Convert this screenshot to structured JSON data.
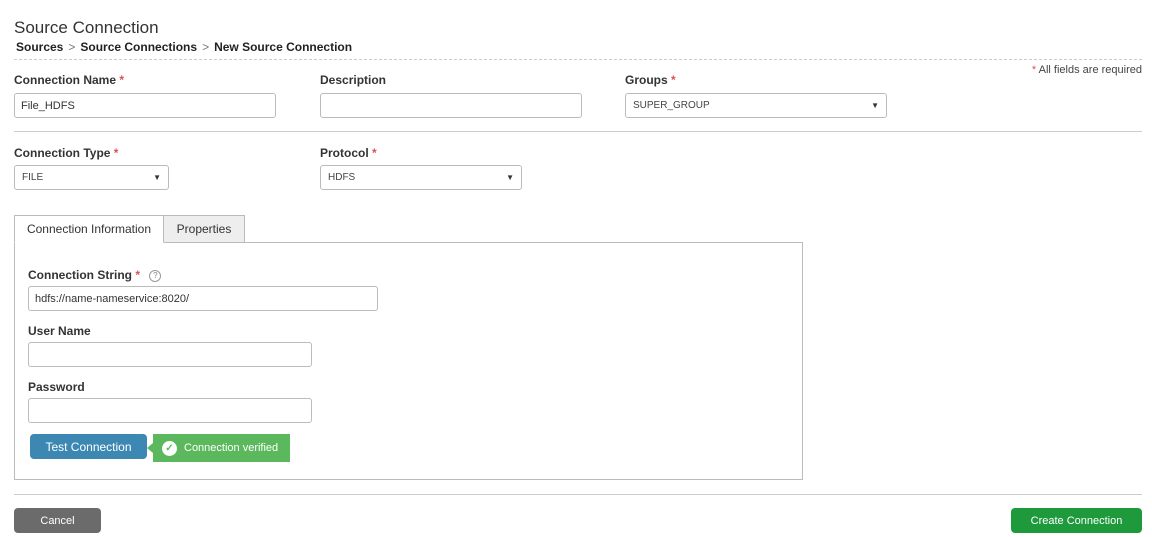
{
  "header": {
    "title": "Source Connection",
    "breadcrumb": [
      "Sources",
      "Source Connections",
      "New Source Connection"
    ],
    "required_note": "All fields are required",
    "required_marker": "*"
  },
  "form": {
    "connection_name": {
      "label": "Connection Name",
      "value": "File_HDFS"
    },
    "description": {
      "label": "Description",
      "value": ""
    },
    "groups": {
      "label": "Groups",
      "value": "SUPER_GROUP"
    },
    "connection_type": {
      "label": "Connection Type",
      "value": "FILE"
    },
    "protocol": {
      "label": "Protocol",
      "value": "HDFS"
    }
  },
  "tabs": [
    {
      "label": "Connection Information",
      "active": true
    },
    {
      "label": "Properties",
      "active": false
    }
  ],
  "connection_info": {
    "connection_string": {
      "label": "Connection String",
      "value": "hdfs://name-nameservice:8020/"
    },
    "user_name": {
      "label": "User Name",
      "value": ""
    },
    "password": {
      "label": "Password",
      "value": ""
    },
    "test_button": "Test Connection",
    "status_message": "Connection verified"
  },
  "footer": {
    "cancel_label": "Cancel",
    "create_label": "Create Connection"
  },
  "icons": {
    "help": "help-circle-icon",
    "check": "check-circle-icon",
    "caret": "caret-down-icon"
  },
  "colors": {
    "required": "#d9534f",
    "test_button": "#3d88b3",
    "verified": "#5cb85c",
    "cancel": "#6b6b6b",
    "create": "#1e9a3c"
  }
}
